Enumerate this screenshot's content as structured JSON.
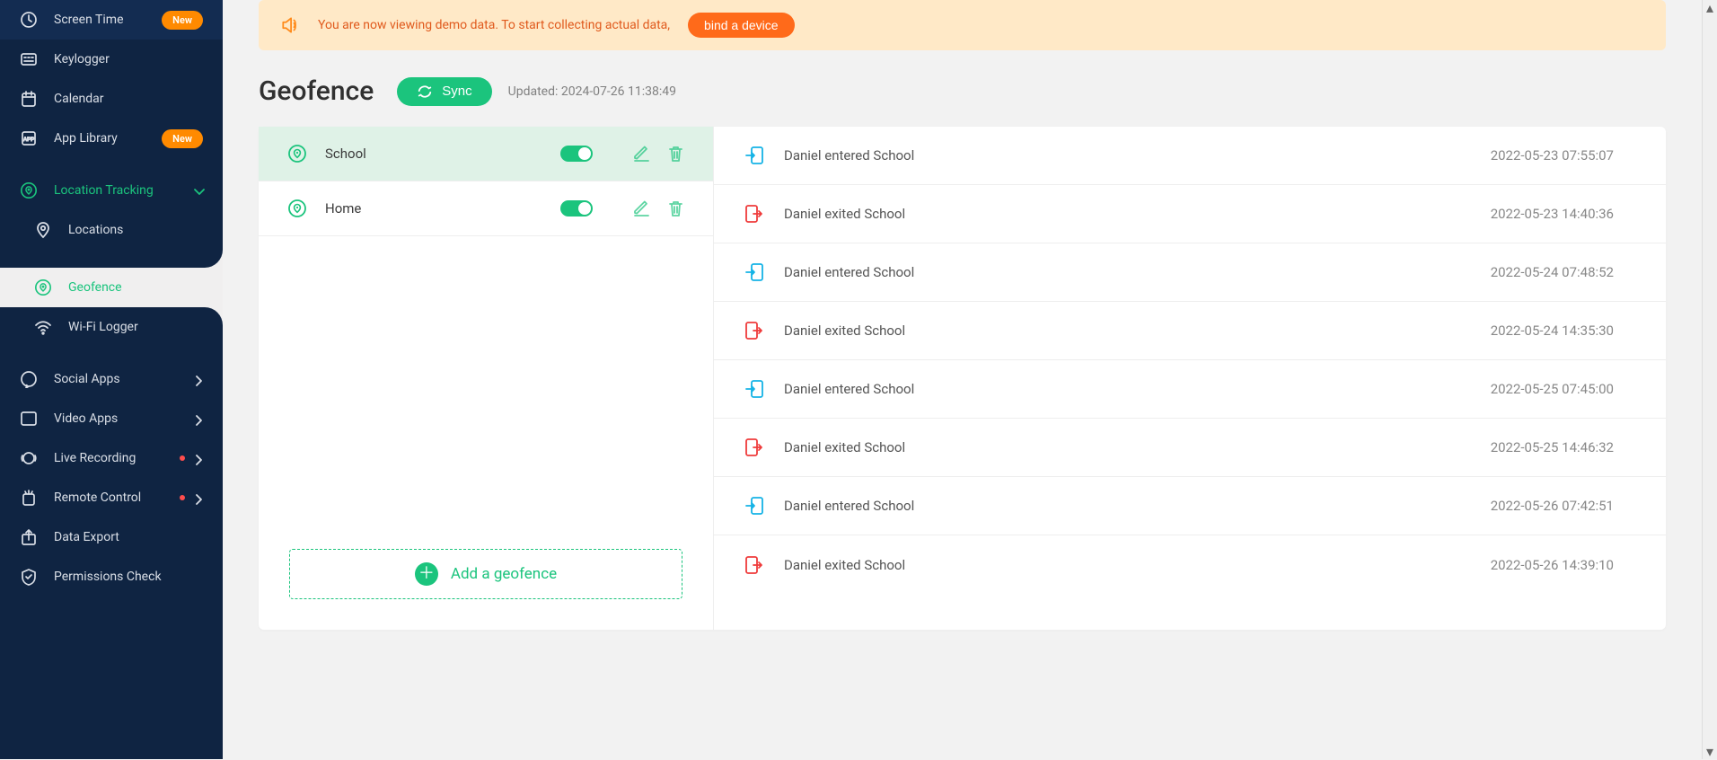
{
  "banner": {
    "text": "You are now viewing demo data. To start collecting actual data,",
    "button": "bind a device"
  },
  "page": {
    "title": "Geofence",
    "sync_label": "Sync",
    "updated_prefix": "Updated: ",
    "updated_time": "2024-07-26 11:38:49",
    "add_geofence": "Add a geofence"
  },
  "sidebar": {
    "screen_time": "Screen Time",
    "keylogger": "Keylogger",
    "calendar": "Calendar",
    "app_library": "App Library",
    "location_tracking": "Location Tracking",
    "locations": "Locations",
    "geofence": "Geofence",
    "wifi_logger": "Wi-Fi Logger",
    "social_apps": "Social Apps",
    "video_apps": "Video Apps",
    "live_recording": "Live Recording",
    "remote_control": "Remote Control",
    "data_export": "Data Export",
    "permissions_check": "Permissions Check",
    "badge_new": "New"
  },
  "geofences": [
    {
      "name": "School",
      "enabled": true,
      "selected": true
    },
    {
      "name": "Home",
      "enabled": true,
      "selected": false
    }
  ],
  "events": [
    {
      "type": "enter",
      "text": "Daniel entered School",
      "time": "2022-05-23 07:55:07"
    },
    {
      "type": "exit",
      "text": "Daniel exited School",
      "time": "2022-05-23 14:40:36"
    },
    {
      "type": "enter",
      "text": "Daniel entered School",
      "time": "2022-05-24 07:48:52"
    },
    {
      "type": "exit",
      "text": "Daniel exited School",
      "time": "2022-05-24 14:35:30"
    },
    {
      "type": "enter",
      "text": "Daniel entered School",
      "time": "2022-05-25 07:45:00"
    },
    {
      "type": "exit",
      "text": "Daniel exited School",
      "time": "2022-05-25 14:46:32"
    },
    {
      "type": "enter",
      "text": "Daniel entered School",
      "time": "2022-05-26 07:42:51"
    },
    {
      "type": "exit",
      "text": "Daniel exited School",
      "time": "2022-05-26 14:39:10"
    }
  ],
  "colors": {
    "primary": "#1bc47d",
    "enter": "#15b3e6",
    "exit": "#ef3b3b",
    "sidebar_bg": "#0f2442",
    "badge": "#ff8a00"
  }
}
